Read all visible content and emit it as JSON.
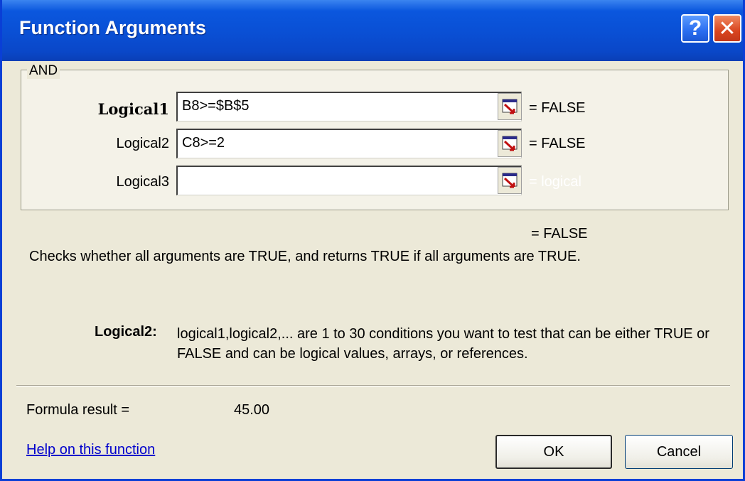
{
  "window": {
    "title": "Function Arguments",
    "help_glyph": "?",
    "close_glyph": "✕"
  },
  "group": {
    "function_name": "AND",
    "args": [
      {
        "label": "Logical1",
        "value": "B8>=$B$5",
        "result": "= FALSE",
        "bold": true
      },
      {
        "label": "Logical2",
        "value": "C8>=2",
        "result": "= FALSE",
        "bold": false
      },
      {
        "label": "Logical3",
        "value": "",
        "result": "= logical",
        "bold": false
      }
    ]
  },
  "formula_value": "= FALSE",
  "description": "Checks whether all arguments are TRUE, and returns TRUE if all arguments are TRUE.",
  "arg_help": {
    "label": "Logical2:",
    "text": "logical1,logical2,... are 1 to 30 conditions you want to test that can be either TRUE or FALSE and can be logical values, arrays, or references."
  },
  "formula_result": {
    "label": "Formula result =",
    "value": "45.00"
  },
  "help_link": "Help on this function",
  "buttons": {
    "ok": "OK",
    "cancel": "Cancel"
  },
  "colors": {
    "title_bar": "#0a4fd4",
    "link": "#0000cc",
    "dialog_bg": "#ece9d8"
  },
  "icons": {
    "ref_button": "range-selector-icon"
  }
}
